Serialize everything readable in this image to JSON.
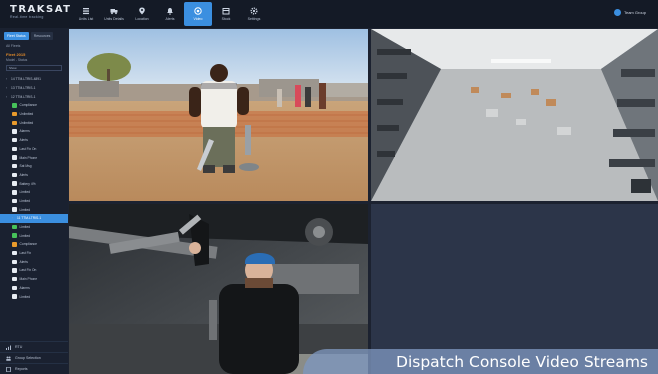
{
  "app": {
    "logo_text": "TRAKSAT",
    "logo_tagline": "Real-time tracking"
  },
  "toolbar": {
    "tools": [
      {
        "label": "Units List",
        "icon": "list-icon"
      },
      {
        "label": "Units Details",
        "icon": "truck-icon"
      },
      {
        "label": "Location",
        "icon": "pin-icon"
      },
      {
        "label": "Alerts",
        "icon": "bell-icon"
      },
      {
        "label": "Video",
        "icon": "camera-icon",
        "active": true
      },
      {
        "label": "Stock",
        "icon": "box-icon"
      },
      {
        "label": "Settings",
        "icon": "gear-icon"
      }
    ],
    "user_name": "Team Group"
  },
  "sidebar": {
    "tabs": [
      "Fleet Status",
      "Resources"
    ],
    "filter": "All Fleets",
    "group_heading": "Fleet 2015",
    "group_sub": "Model - Status",
    "select_value": "Show",
    "rows": [
      {
        "label": "14 TTM-LTRIS-4891",
        "type": "caret"
      },
      {
        "label": "13 TTM-LTRIS-1",
        "type": "caret"
      },
      {
        "label": "12 TTM-LTRIS-1",
        "type": "caret"
      },
      {
        "label": "Compliance",
        "type": "green"
      },
      {
        "label": "Unlimited",
        "type": "orange"
      },
      {
        "label": "Unlimited",
        "type": "orange"
      },
      {
        "label": "Alarms",
        "type": "white"
      },
      {
        "label": "Alerts",
        "type": "white"
      },
      {
        "label": "Last Fix On",
        "type": "white"
      },
      {
        "label": "Main Phone",
        "type": "white"
      },
      {
        "label": "Sat Msg",
        "type": "white"
      },
      {
        "label": "Alerts",
        "type": "white"
      },
      {
        "label": "Battery 4%",
        "type": "white"
      },
      {
        "label": "Limited",
        "type": "white"
      },
      {
        "label": "Limited",
        "type": "white"
      },
      {
        "label": "Limited",
        "type": "white"
      },
      {
        "label": "11 TTM-LTRIS-1",
        "type": "selected"
      },
      {
        "label": "Limited",
        "type": "green"
      },
      {
        "label": "Limited",
        "type": "green"
      },
      {
        "label": "Compliance",
        "type": "orange"
      },
      {
        "label": "Last Fix",
        "type": "white"
      },
      {
        "label": "Alerts",
        "type": "white"
      },
      {
        "label": "Last Fix On",
        "type": "white"
      },
      {
        "label": "Main Phone",
        "type": "white"
      },
      {
        "label": "Alarms",
        "type": "white"
      },
      {
        "label": "Limited",
        "type": "white"
      }
    ],
    "footer": [
      {
        "label": "RTU",
        "icon": "signal-icon"
      },
      {
        "label": "Group Selection",
        "icon": "group-icon"
      },
      {
        "label": "Reports",
        "icon": "report-icon"
      }
    ]
  },
  "video": {
    "streams": [
      {
        "name": "camera-stream-1",
        "scene": "field-worker"
      },
      {
        "name": "camera-stream-2",
        "scene": "warehouse"
      },
      {
        "name": "camera-stream-3",
        "scene": "mechanic"
      },
      {
        "name": "camera-stream-4",
        "scene": "empty"
      }
    ]
  },
  "caption": "Dispatch Console Video Streams",
  "colors": {
    "accent": "#3b8fe0",
    "sidebar_bg": "#1a2130",
    "caption_bg": "#7e96be"
  }
}
